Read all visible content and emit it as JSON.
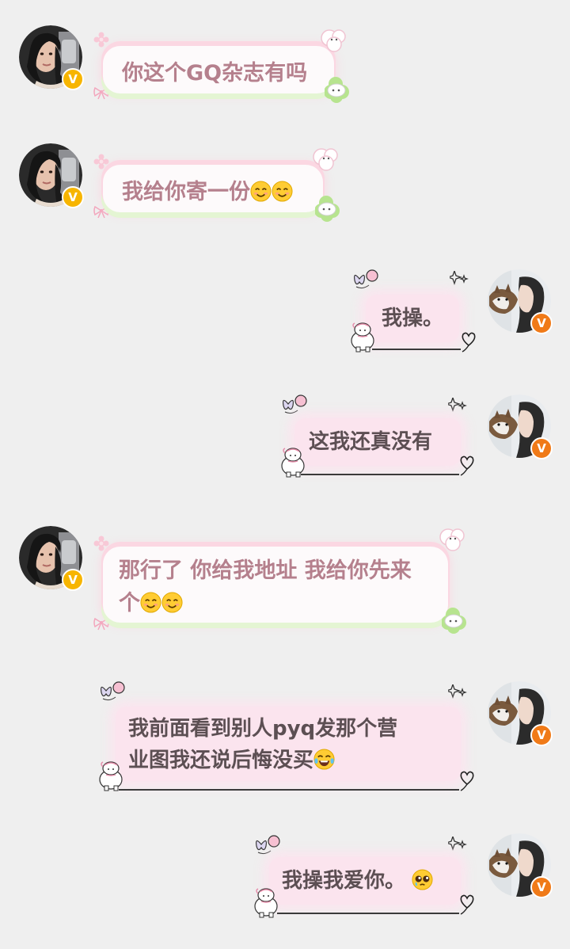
{
  "conversation": {
    "messages": [
      {
        "side": "left",
        "text": "你这个GQ杂志有吗",
        "emojis": []
      },
      {
        "side": "left",
        "text": "我给你寄一份",
        "emojis": [
          "smiling-face",
          "smiling-face"
        ]
      },
      {
        "side": "right",
        "text": "我操。",
        "emojis": []
      },
      {
        "side": "right",
        "text": "这我还真没有",
        "emojis": []
      },
      {
        "side": "left",
        "line1": "那行了 你给我地址 我给你先来",
        "line2": "个",
        "emojis": [
          "smiling-face",
          "smiling-face"
        ]
      },
      {
        "side": "right",
        "line1": "我前面看到别人pyq发那个营",
        "line2": "业图我还说后悔没买",
        "emojis": [
          "tears-of-joy"
        ]
      },
      {
        "side": "right",
        "text": "我操我爱你。",
        "emojis": [
          "pleading-face"
        ]
      }
    ]
  },
  "avatars": {
    "left_badge": "V",
    "right_badge": "V"
  },
  "colors": {
    "background": "#efefef",
    "left_text": "#b5808d",
    "right_text": "#5c4f53",
    "left_badge": "#f7b500",
    "right_badge": "#f07a18"
  }
}
